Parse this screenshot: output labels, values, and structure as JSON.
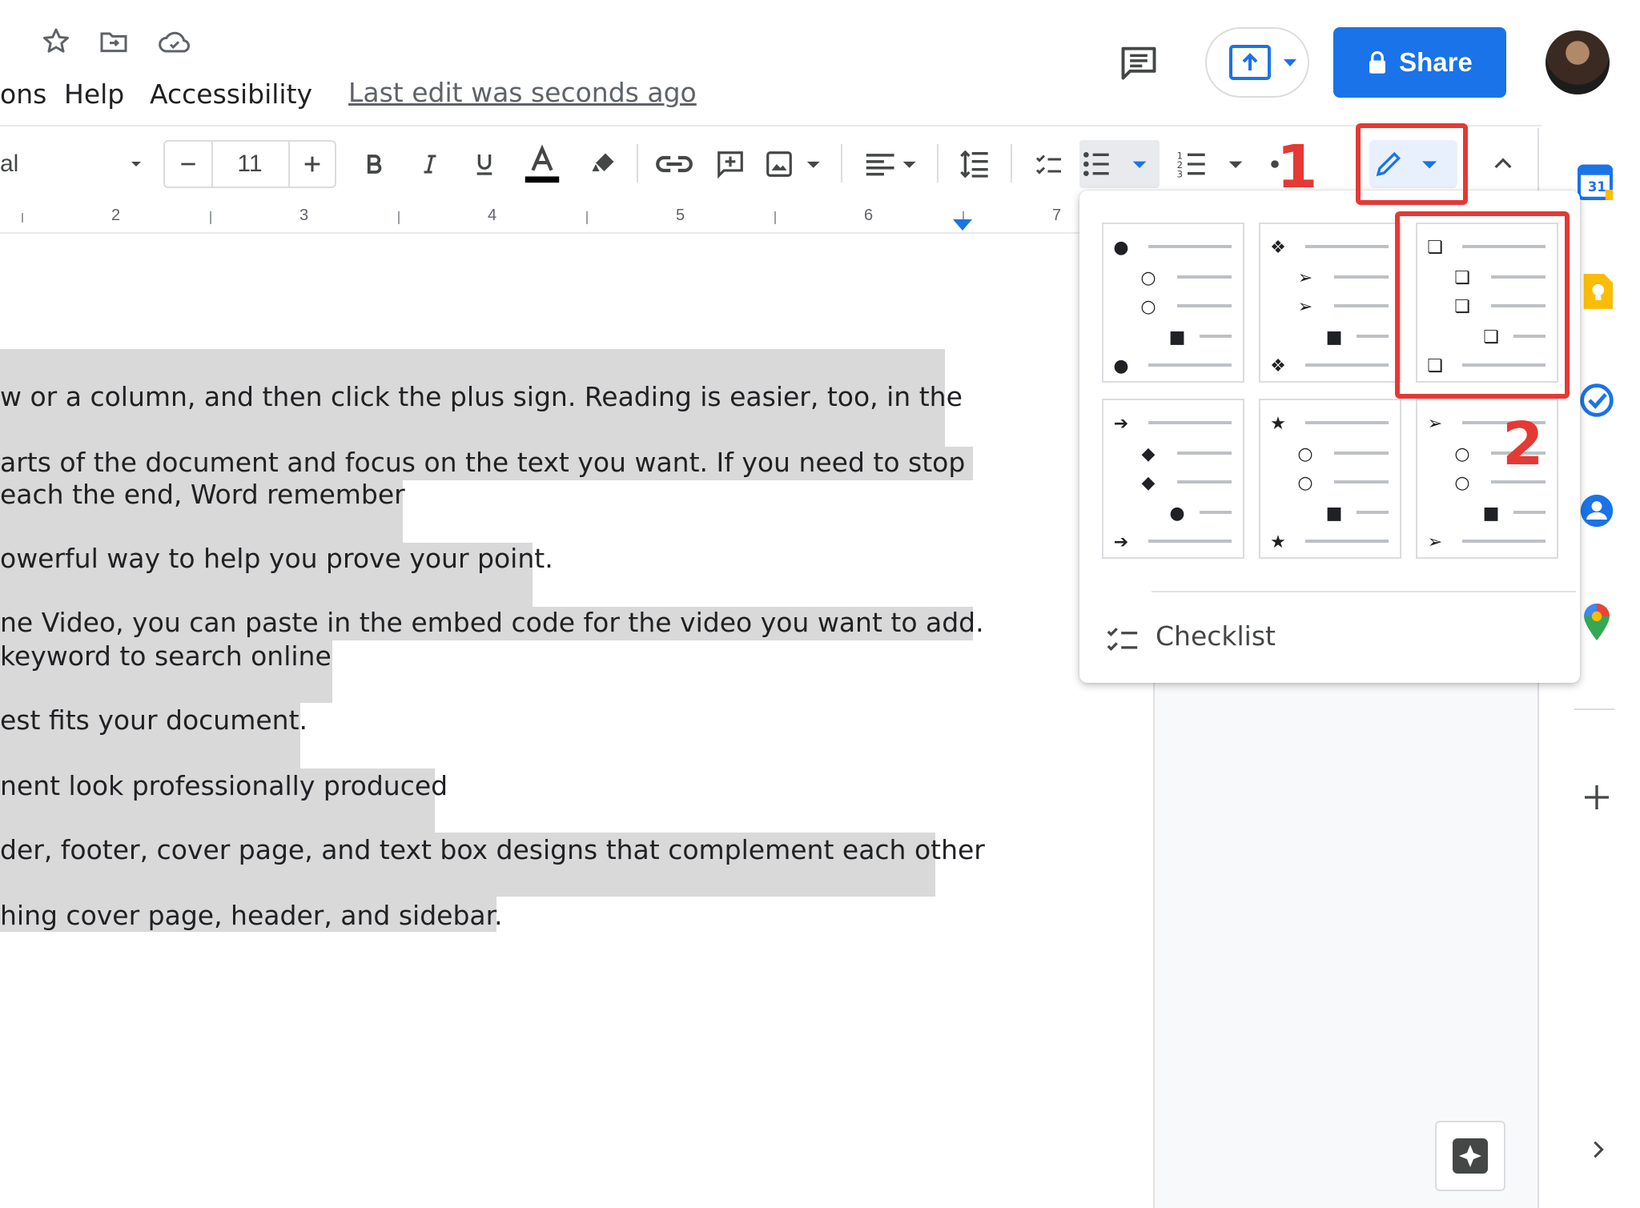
{
  "header": {
    "menu": [
      "ons",
      "Help",
      "Accessibility"
    ],
    "last_edit": "Last edit was seconds ago",
    "share_label": "Share"
  },
  "toolbar": {
    "font_name": "al",
    "font_size": "11"
  },
  "ruler": {
    "numbers": [
      "2",
      "3",
      "4",
      "5",
      "6",
      "7"
    ]
  },
  "document": {
    "lines": [
      "w or a column, and then click the plus sign. Reading is easier, too, in the",
      "arts of the document and focus on the text you want. If you need to stop",
      "each the end, Word remember",
      "owerful way to help you prove your point.",
      "ne Video, you can paste in the embed code for the video you want to add.",
      "keyword to search online",
      "est fits your document.",
      "nent look professionally produced",
      "der, footer, cover page, and text box designs that complement each other",
      "hing cover page, header, and sidebar."
    ]
  },
  "bullet_menu": {
    "presets": [
      {
        "name": "disc-circle-square",
        "symbols": [
          "●",
          "○",
          "○",
          "■",
          "●"
        ]
      },
      {
        "name": "diamond-arrowhead",
        "symbols": [
          "❖",
          "➢",
          "➢",
          "■",
          "❖"
        ]
      },
      {
        "name": "checkbox",
        "symbols": [
          "❏",
          "❏",
          "❏",
          "❏",
          "❏"
        ]
      },
      {
        "name": "arrow-diamond",
        "symbols": [
          "➔",
          "◆",
          "◆",
          "●",
          "➔"
        ]
      },
      {
        "name": "star-circle",
        "symbols": [
          "★",
          "○",
          "○",
          "■",
          "★"
        ]
      },
      {
        "name": "arrowhead-circle",
        "symbols": [
          "➢",
          "○",
          "○",
          "■",
          "➢"
        ]
      }
    ],
    "checklist_label": "Checklist"
  },
  "annotations": {
    "step1": "1",
    "step2": "2"
  },
  "colors": {
    "accent": "#1a73e8",
    "highlight": "#d9d9d9",
    "annotation": "#e53935"
  }
}
